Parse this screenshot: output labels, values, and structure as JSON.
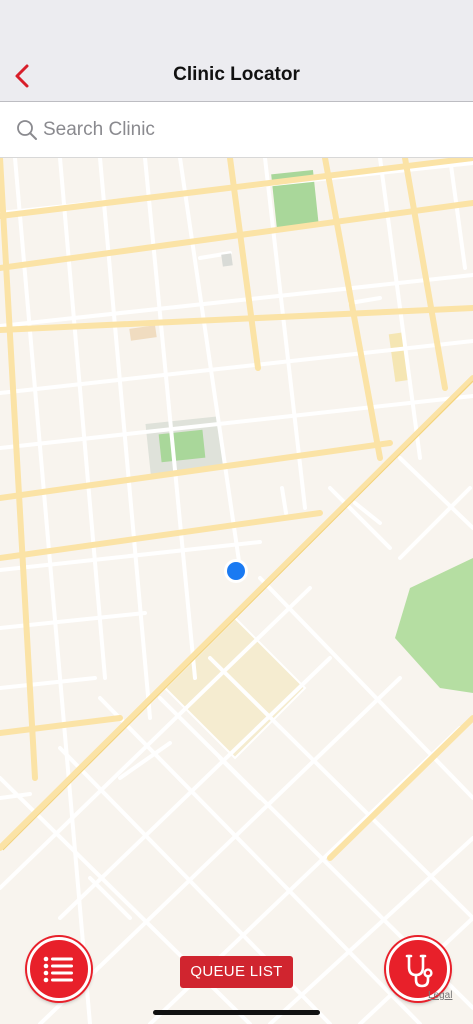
{
  "header": {
    "title": "Clinic Locator"
  },
  "search": {
    "placeholder": "Search Clinic",
    "value": ""
  },
  "map": {
    "legal_label": "Legal"
  },
  "actions": {
    "queue_label": "QUEUE LIST"
  },
  "colors": {
    "accent": "#e8202a",
    "location": "#1a7af2",
    "park": "#a9d79a",
    "road": "#fbe3a6"
  }
}
